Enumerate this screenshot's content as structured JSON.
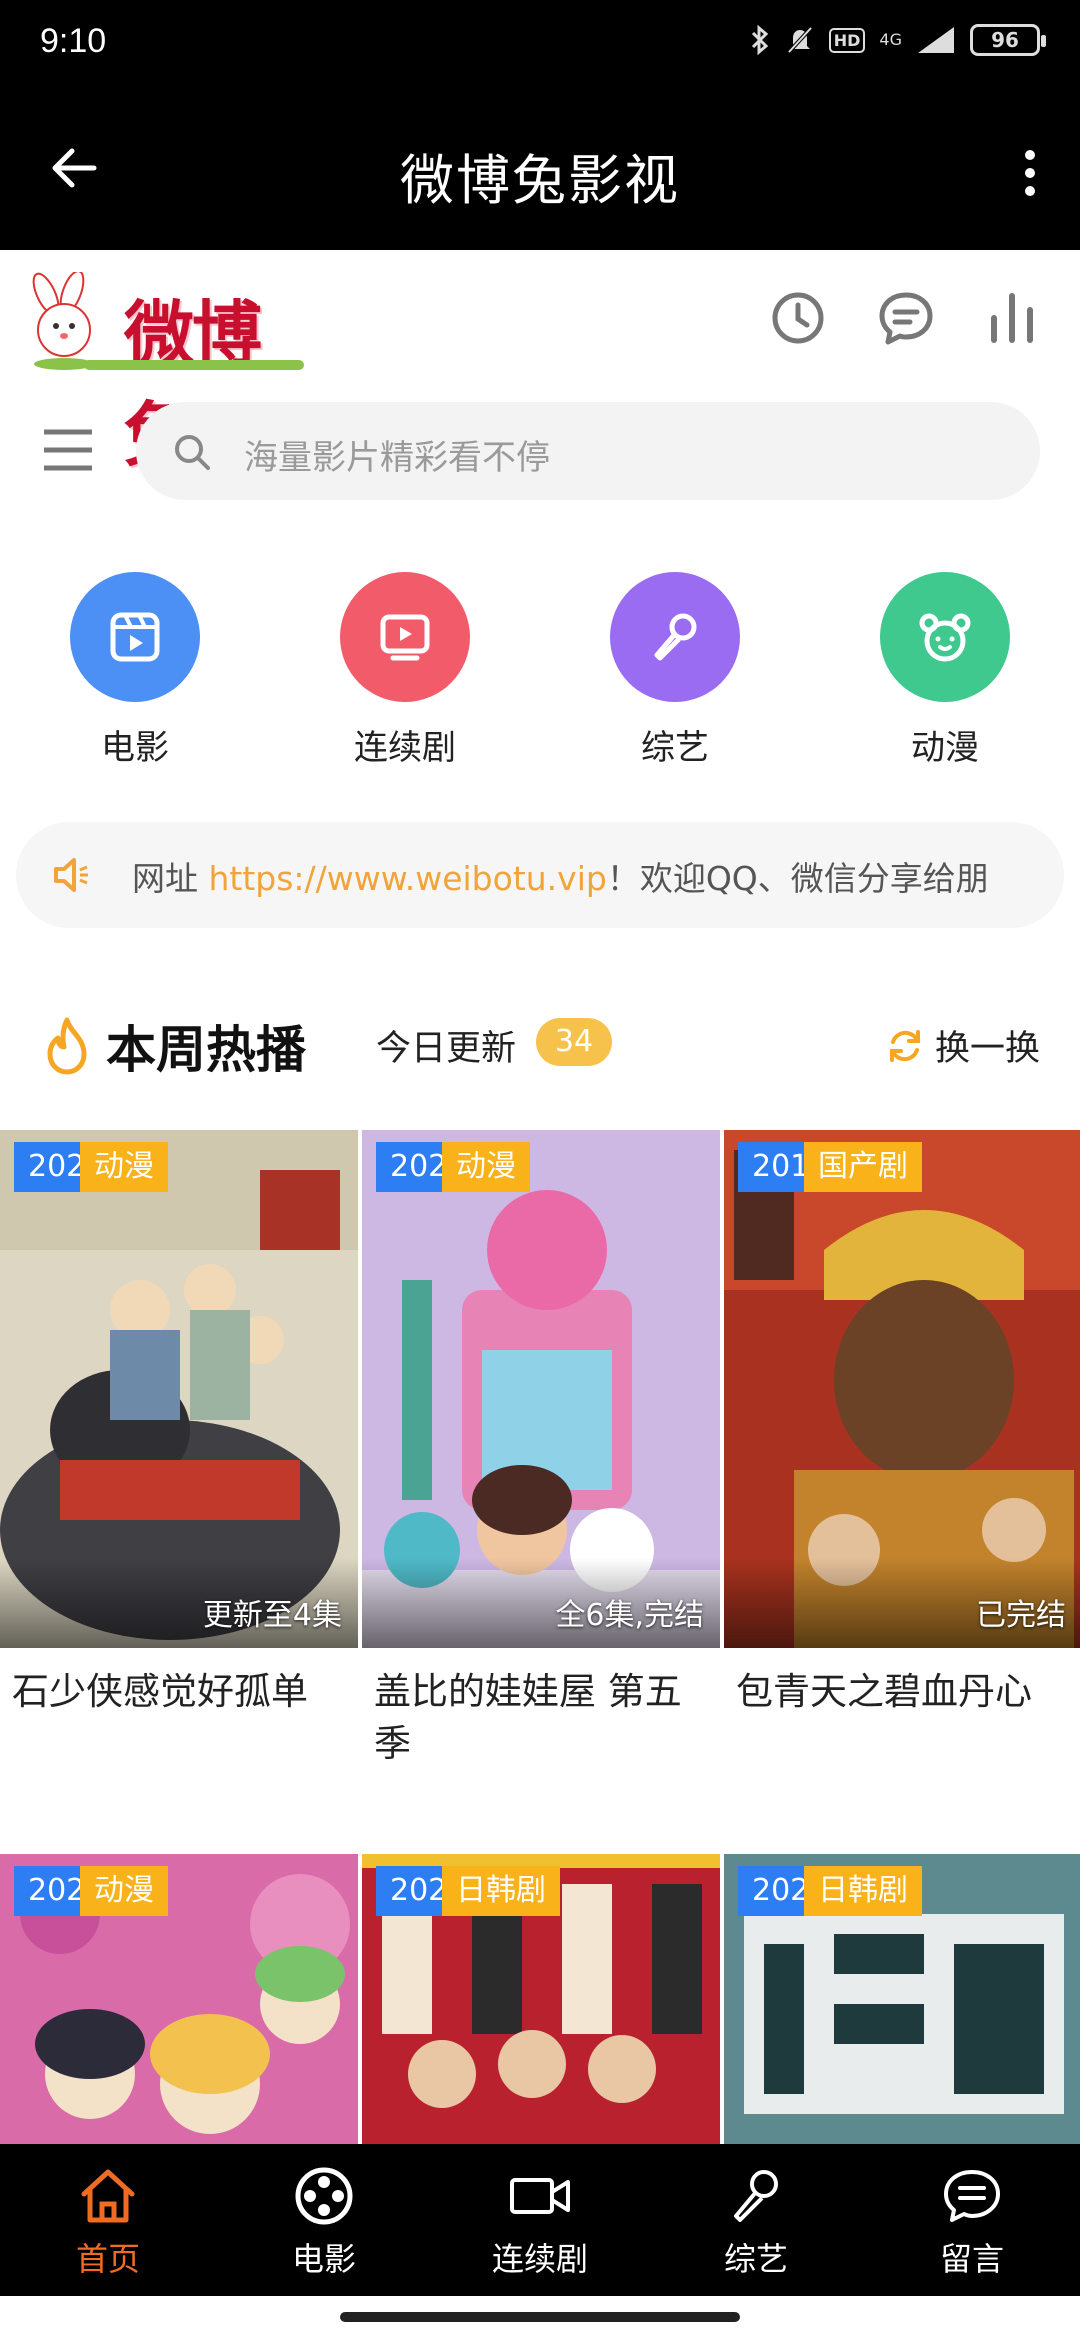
{
  "status_bar": {
    "time": "9:10",
    "network": "4G",
    "battery": "96",
    "hd": "HD"
  },
  "app_bar": {
    "title": "微博兔影视"
  },
  "logo": {
    "text": "微博兔"
  },
  "search": {
    "placeholder": "海量影片精彩看不停"
  },
  "categories": [
    {
      "label": "电影",
      "icon": "film-icon",
      "color": "#4c8ff5"
    },
    {
      "label": "连续剧",
      "icon": "tv-icon",
      "color": "#f25b6a"
    },
    {
      "label": "综艺",
      "icon": "microphone-icon",
      "color": "#9a6cf2"
    },
    {
      "label": "动漫",
      "icon": "bear-face-icon",
      "color": "#3fc98f"
    }
  ],
  "notice": {
    "prefix": "网址 ",
    "link": "https://www.weibotu.vip",
    "suffix": "！欢迎QQ、微信分享给朋"
  },
  "section": {
    "title": "本周热播",
    "today_label": "今日更新",
    "today_count": "34",
    "refresh_label": "换一换"
  },
  "items": [
    {
      "year": "2022",
      "genre": "动漫",
      "status": "更新至4集",
      "title": "石少侠感觉好孤单"
    },
    {
      "year": "2022",
      "genre": "动漫",
      "status": "全6集,完结",
      "title": "盖比的娃娃屋 第五季"
    },
    {
      "year": "2010",
      "genre": "国产剧",
      "status": "已完结",
      "title": "包青天之碧血丹心"
    },
    {
      "year": "2021",
      "genre": "动漫",
      "status": "",
      "title": ""
    },
    {
      "year": "2022",
      "genre": "日韩剧",
      "status": "",
      "title": ""
    },
    {
      "year": "2022",
      "genre": "日韩剧",
      "status": "",
      "title": ""
    }
  ],
  "bottom_nav": [
    {
      "label": "首页",
      "icon": "home-icon",
      "active": true
    },
    {
      "label": "电影",
      "icon": "film-reel-icon",
      "active": false
    },
    {
      "label": "连续剧",
      "icon": "video-camera-icon",
      "active": false
    },
    {
      "label": "综艺",
      "icon": "microphone-icon",
      "active": false
    },
    {
      "label": "留言",
      "icon": "chat-bubble-icon",
      "active": false
    }
  ],
  "colors": {
    "accent": "#f06c22",
    "year_tag": "#2d7df3",
    "genre_tag": "#f9b21a",
    "link": "#f0a43a"
  }
}
